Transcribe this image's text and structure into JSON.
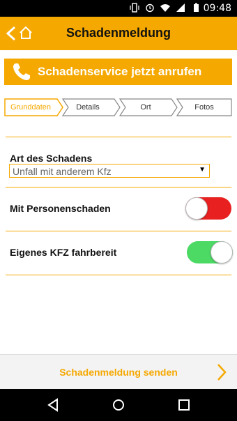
{
  "status_bar": {
    "time": "09:48",
    "icons": [
      "vibrate-icon",
      "alarm-icon",
      "wifi-icon",
      "signal-icon",
      "battery-icon"
    ]
  },
  "app_bar": {
    "title": "Schadenmeldung"
  },
  "call_bar": {
    "label": "Schadenservice jetzt anrufen"
  },
  "steps": [
    {
      "label": "Grunddaten",
      "active": true
    },
    {
      "label": "Details",
      "active": false
    },
    {
      "label": "Ort",
      "active": false
    },
    {
      "label": "Fotos",
      "active": false
    }
  ],
  "form": {
    "damage_type": {
      "label": "Art des Schadens",
      "value": "Unfall mit anderem Kfz"
    },
    "personal_injury": {
      "label": "Mit Personenschaden",
      "on": false
    },
    "drivable": {
      "label": "Eigenes KFZ fahrbereit",
      "on": true
    }
  },
  "footer": {
    "submit_label": "Schadenmeldung senden"
  },
  "colors": {
    "accent": "#f5a800",
    "toggle_off": "#e82020",
    "toggle_on": "#4cd964"
  }
}
